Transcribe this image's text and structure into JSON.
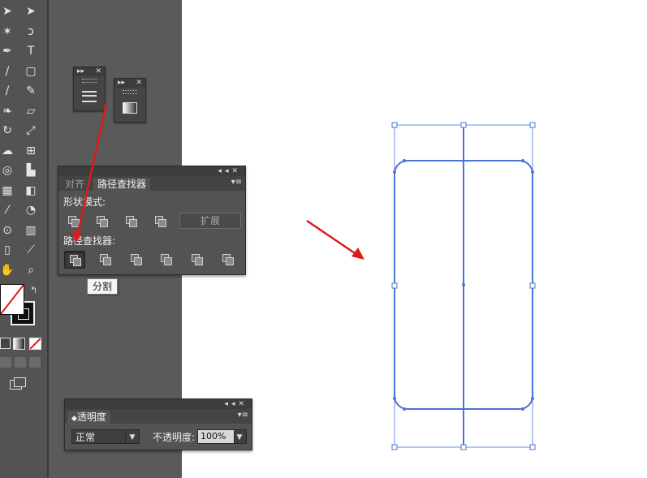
{
  "toolbar": {
    "tools": [
      {
        "name": "selection-tool",
        "glyph": "➤"
      },
      {
        "name": "direct-selection-tool",
        "glyph": "➤"
      },
      {
        "name": "magic-wand-tool",
        "glyph": "✶"
      },
      {
        "name": "lasso-tool",
        "glyph": "ↄ"
      },
      {
        "name": "pen-tool",
        "glyph": "✒"
      },
      {
        "name": "type-tool",
        "glyph": "T"
      },
      {
        "name": "line-tool",
        "glyph": "/"
      },
      {
        "name": "rectangle-tool",
        "glyph": "▢"
      },
      {
        "name": "paintbrush-tool",
        "glyph": "/"
      },
      {
        "name": "pencil-tool",
        "glyph": "✎"
      },
      {
        "name": "blob-brush-tool",
        "glyph": "❧"
      },
      {
        "name": "eraser-tool",
        "glyph": "▱"
      },
      {
        "name": "rotate-tool",
        "glyph": "↻"
      },
      {
        "name": "scale-tool",
        "glyph": "⤢"
      },
      {
        "name": "warp-tool",
        "glyph": "☁"
      },
      {
        "name": "free-transform-tool",
        "glyph": "⊞"
      },
      {
        "name": "shape-builder-tool",
        "glyph": "◎"
      },
      {
        "name": "graph-tool",
        "glyph": "▙"
      },
      {
        "name": "mesh-tool",
        "glyph": "▦"
      },
      {
        "name": "gradient-tool",
        "glyph": "◧"
      },
      {
        "name": "eyedropper-tool",
        "glyph": "⁄"
      },
      {
        "name": "blend-tool",
        "glyph": "◔"
      },
      {
        "name": "symbol-sprayer-tool",
        "glyph": "⊙"
      },
      {
        "name": "column-graph-tool",
        "glyph": "▥"
      },
      {
        "name": "artboard-tool",
        "glyph": "▯"
      },
      {
        "name": "slice-tool",
        "glyph": "⟋"
      },
      {
        "name": "hand-tool",
        "glyph": "✋"
      },
      {
        "name": "zoom-tool",
        "glyph": "⌕"
      }
    ]
  },
  "pathfinder_panel": {
    "tabs": [
      "对齐",
      "路径查找器"
    ],
    "active_tab": "路径查找器",
    "shape_modes_label": "形状模式:",
    "expand_label": "扩展",
    "pathfinders_label": "路径查找器:",
    "selected_button": "分割"
  },
  "tooltip": {
    "text": "分割"
  },
  "transparency_panel": {
    "tab": "透明度",
    "blend_mode": "正常",
    "opacity_label": "不透明度:",
    "opacity_value": "100%"
  },
  "colors": {
    "path": "#4a73d6",
    "arrow": "#e0191a",
    "toolbar_bg": "#535353",
    "panel_bg": "#535353"
  }
}
